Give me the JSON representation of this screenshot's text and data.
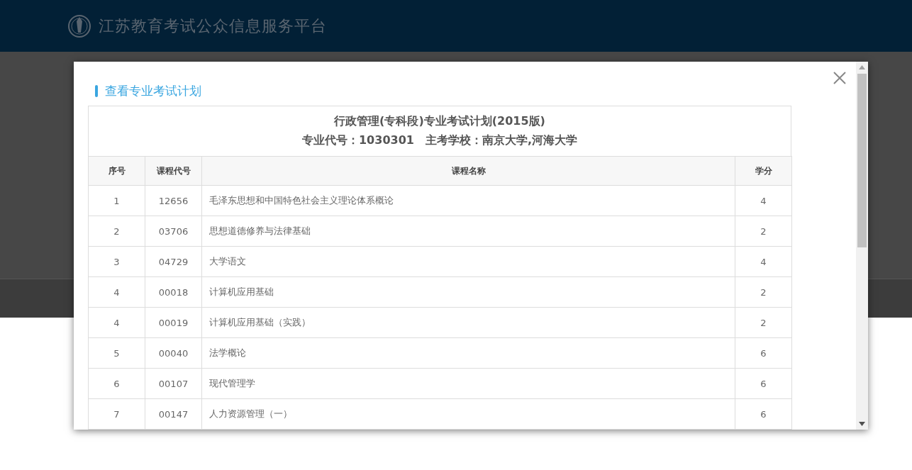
{
  "site": {
    "title": "江苏教育考试公众信息服务平台"
  },
  "dialog": {
    "title": "查看专业考试计划",
    "plan_title": "行政管理(专科段)专业考试计划(2015版)",
    "major_code_label": "专业代号：",
    "major_code": "1030301",
    "school_label": "主考学校：",
    "school": "南京大学,河海大学"
  },
  "table": {
    "columns": [
      "序号",
      "课程代号",
      "课程名称",
      "学分"
    ],
    "rows": [
      [
        "1",
        "12656",
        "毛泽东思想和中国特色社会主义理论体系概论",
        "4"
      ],
      [
        "2",
        "03706",
        "思想道德修养与法律基础",
        "2"
      ],
      [
        "3",
        "04729",
        "大学语文",
        "4"
      ],
      [
        "4",
        "00018",
        "计算机应用基础",
        "2"
      ],
      [
        "4",
        "00019",
        "计算机应用基础（实践）",
        "2"
      ],
      [
        "5",
        "00040",
        "法学概论",
        "6"
      ],
      [
        "6",
        "00107",
        "现代管理学",
        "6"
      ],
      [
        "7",
        "00147",
        "人力资源管理（一）",
        "6"
      ]
    ]
  }
}
